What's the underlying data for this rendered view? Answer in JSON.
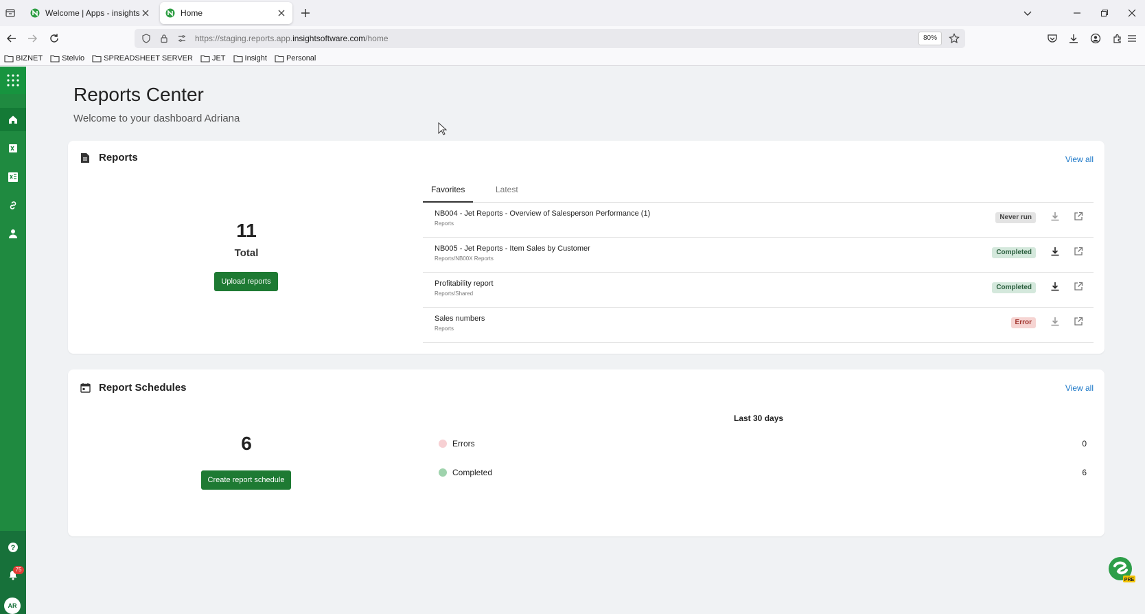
{
  "browser": {
    "tabs": [
      {
        "label": "Welcome | Apps - insightsoftware",
        "active": false
      },
      {
        "label": "Home",
        "active": true
      }
    ],
    "url_prefix": "https://staging.reports.app.",
    "url_domain": "insightsoftware.com",
    "url_path": "/home",
    "zoom": "80%",
    "bookmarks": [
      "BIZNET",
      "Stelvio",
      "SPREADSHEET SERVER",
      "JET",
      "Insight",
      "Personal"
    ]
  },
  "rail": {
    "notification_count": "75",
    "avatar_initials": "AR",
    "accent": "#1f8a40"
  },
  "page": {
    "title": "Reports Center",
    "subtitle": "Welcome to your dashboard Adriana"
  },
  "reports": {
    "title": "Reports",
    "view_all": "View all",
    "total": "11",
    "total_label": "Total",
    "upload_button": "Upload reports",
    "tabs": [
      "Favorites",
      "Latest"
    ],
    "active_tab": "Favorites",
    "items": [
      {
        "name": "NB004 - Jet Reports - Overview of Salesperson Performance (1)",
        "path": "Reports",
        "status": "Never run"
      },
      {
        "name": "NB005 - Jet Reports - Item Sales by Customer",
        "path": "Reports/NB00X Reports",
        "status": "Completed"
      },
      {
        "name": "Profitability report",
        "path": "Reports/Shared",
        "status": "Completed"
      },
      {
        "name": "Sales numbers",
        "path": "Reports",
        "status": "Error"
      }
    ]
  },
  "schedules": {
    "title": "Report Schedules",
    "view_all": "View all",
    "total": "6",
    "create_button": "Create report schedule",
    "period": "Last 30 days",
    "legend": [
      {
        "label": "Errors",
        "value": "0",
        "color": "#f7d0d3"
      },
      {
        "label": "Completed",
        "value": "6",
        "color": "#9fd3ad"
      }
    ]
  },
  "colors": {
    "primary_button": "#1e7a33",
    "link": "#1976c7",
    "badge_completed": "#d4e8dc",
    "badge_error": "#f6d4d2",
    "badge_never": "#e3e3e3"
  },
  "pre_badge": "PRE"
}
